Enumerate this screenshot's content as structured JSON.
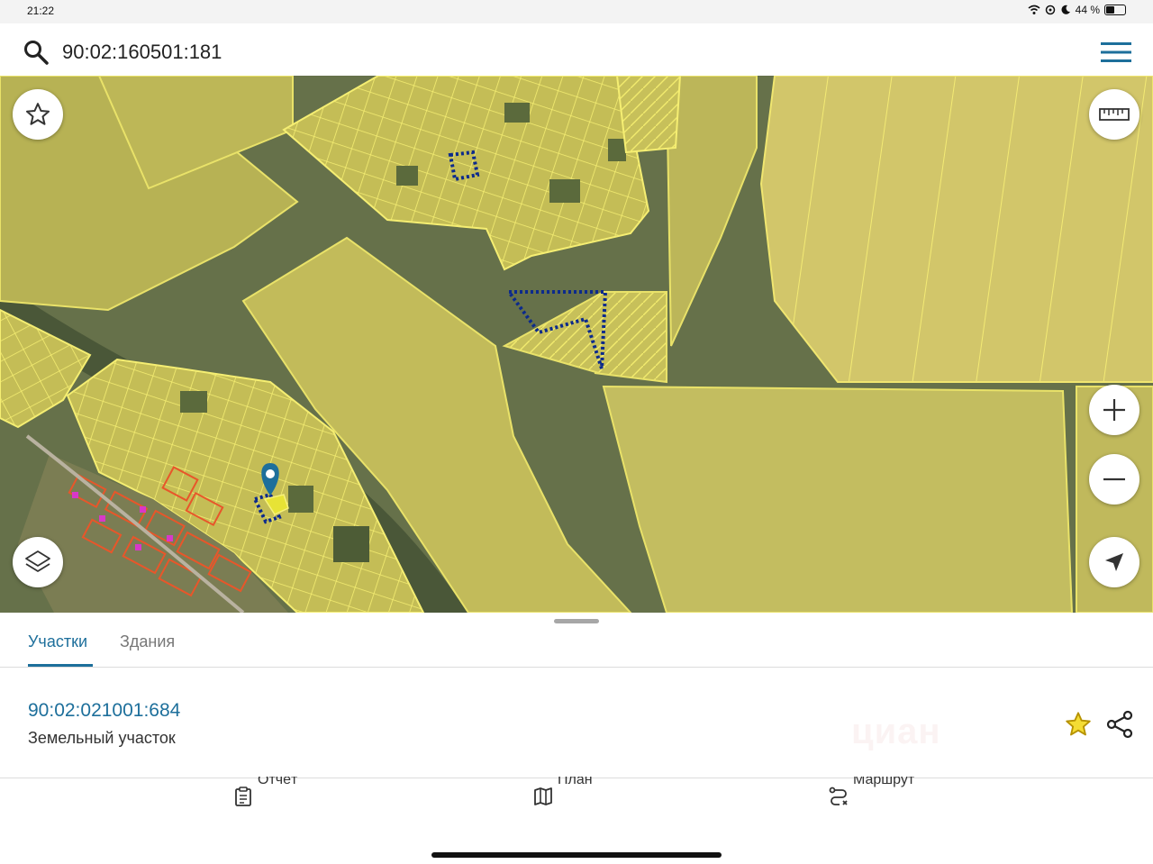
{
  "status_bar": {
    "time": "21:22",
    "battery": "44 %"
  },
  "search": {
    "query": "90:02:160501:181"
  },
  "icons": {
    "search": "search-icon",
    "menu": "hamburger-menu-icon",
    "favorite": "star-icon",
    "ruler": "ruler-icon",
    "zoom_in": "plus-icon",
    "zoom_out": "minus-icon",
    "layers": "layers-icon",
    "locate": "navigation-arrow-icon",
    "share": "share-icon",
    "report": "clipboard-icon",
    "plan": "map-icon",
    "route": "route-icon"
  },
  "colors": {
    "accent": "#1d6f9b",
    "parcel_fill": "#c9c25a",
    "parcel_border": "#f2eb6e",
    "selected_border": "#0c2a8c",
    "building_border": "#e8562a",
    "favorite_star": "#d4b300"
  },
  "bottom_sheet": {
    "tabs": [
      {
        "label": "Участки",
        "active": true
      },
      {
        "label": "Здания",
        "active": false
      }
    ],
    "result": {
      "cadastral_number": "90:02:021001:684",
      "type": "Земельный участок"
    },
    "actions": [
      {
        "label": "Отчёт"
      },
      {
        "label": "План"
      },
      {
        "label": "Маршрут"
      }
    ],
    "watermark": "циан"
  }
}
